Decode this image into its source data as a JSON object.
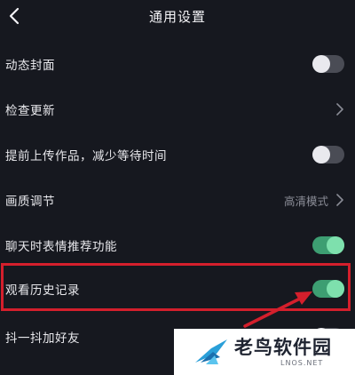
{
  "header": {
    "title": "通用设置"
  },
  "settings": {
    "items": [
      {
        "label": "动态封面",
        "control": "toggle",
        "state": "off"
      },
      {
        "label": "检查更新",
        "control": "chevron"
      },
      {
        "label": "提前上传作品，减少等待时间",
        "control": "toggle",
        "state": "off"
      },
      {
        "label": "画质调节",
        "control": "chevron",
        "value": "高清模式"
      },
      {
        "label": "聊天时表情推荐功能",
        "control": "toggle",
        "state": "on"
      },
      {
        "label": "观看历史记录",
        "control": "toggle",
        "state": "on",
        "highlighted": true
      },
      {
        "label": "抖一抖加好友",
        "control": "toggle",
        "state": "off"
      }
    ]
  },
  "annotation": {
    "highlight_color": "#d41f2c"
  },
  "watermark": {
    "name": "老鸟软件园",
    "url": "LNOS.NET"
  },
  "colors": {
    "background": "#16181f",
    "toggle_on": "#3d9e72",
    "toggle_off": "#4a4c55"
  }
}
